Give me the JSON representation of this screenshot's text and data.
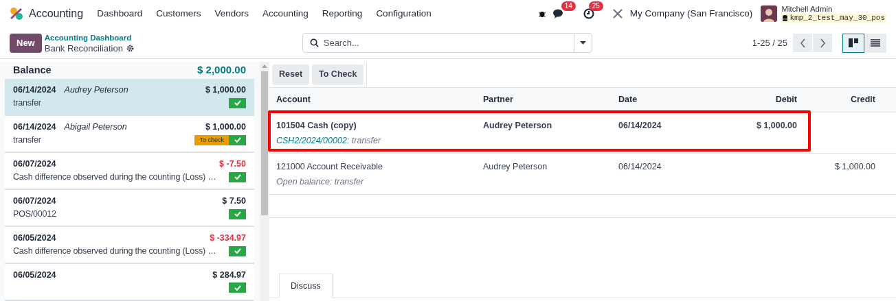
{
  "app": {
    "name": "Accounting"
  },
  "menu": [
    "Dashboard",
    "Customers",
    "Vendors",
    "Accounting",
    "Reporting",
    "Configuration"
  ],
  "systray": {
    "messages_count": "14",
    "activities_count": "25",
    "company": "My Company (San Francisco)",
    "user": "Mitchell Admin",
    "database": "kmp_2_test_may_30_pos"
  },
  "control_bar": {
    "new_button": "New",
    "breadcrumb": "Accounting Dashboard",
    "title": "Bank Reconciliation",
    "search": {
      "placeholder": "Search..."
    },
    "pager": "1-25 / 25",
    "views": [
      {
        "kind": "kanban",
        "selected": true
      },
      {
        "kind": "list",
        "selected": false
      }
    ]
  },
  "statements": {
    "balance_label": "Balance",
    "balance": "$ 2,000.00",
    "items": [
      {
        "date": "06/14/2024",
        "partner": "Audrey Peterson",
        "amount": "$ 1,000.00",
        "negative": false,
        "label": "transfer",
        "selected": true
      },
      {
        "date": "06/14/2024",
        "partner": "Abigail Peterson",
        "amount": "$ 1,000.00",
        "negative": false,
        "label": "transfer",
        "to_check_label": "To check",
        "selected": false
      },
      {
        "date": "06/07/2024",
        "amount": "$ -7.50",
        "negative": true,
        "label": "Cash difference observed during the counting (Loss) …",
        "selected": false
      },
      {
        "date": "06/07/2024",
        "amount": "$ 7.50",
        "negative": false,
        "label": "POS/00012",
        "selected": false
      },
      {
        "date": "06/05/2024",
        "amount": "$ -334.97",
        "negative": true,
        "label": "Cash difference observed during the counting (Loss) …",
        "selected": false
      },
      {
        "date": "06/05/2024",
        "amount": "$ 284.97",
        "negative": false,
        "selected": false
      }
    ]
  },
  "actions": [
    "Reset",
    "To Check"
  ],
  "lines": {
    "columns": [
      "Account",
      "Partner",
      "Date",
      "Debit",
      "Credit"
    ],
    "rows": [
      {
        "account": "101504 Cash (copy)",
        "reference": "CSH2/2024/00002",
        "note": ": transfer",
        "partner": "Audrey Peterson",
        "date": "06/14/2024",
        "debit": "$ 1,000.00",
        "bold": true,
        "highlighted": true
      },
      {
        "account": "121000 Account Receivable",
        "note": "Open balance: transfer",
        "partner": "Audrey Peterson",
        "date": "06/14/2024",
        "credit": "$ 1,000.00",
        "bold": false,
        "highlighted": false
      }
    ]
  },
  "tabs": [
    {
      "label": "Discuss",
      "selected": true
    }
  ]
}
